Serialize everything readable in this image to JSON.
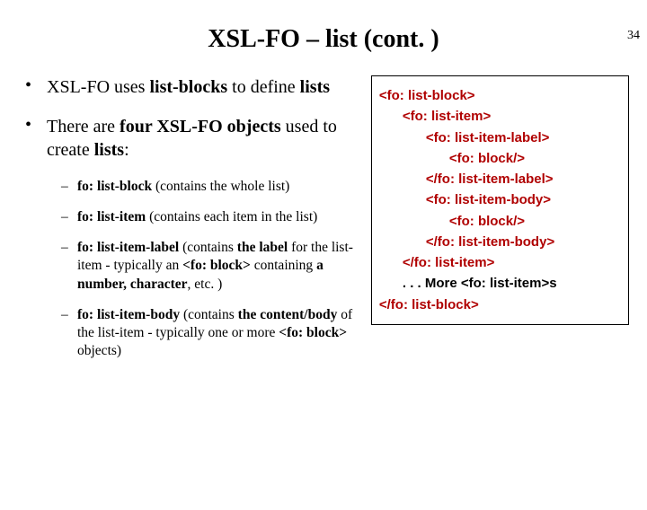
{
  "page_number": "34",
  "title": "XSL-FO – list (cont. )",
  "bullets": {
    "b1": {
      "pre": "XSL-FO uses ",
      "bold1": "list-blocks",
      "mid": " to define ",
      "bold2": "lists"
    },
    "b2": {
      "pre": "There are ",
      "bold1": "four XSL-FO objects",
      "mid": " used to create ",
      "bold2": "lists",
      "post": ":"
    }
  },
  "subs": {
    "s1": {
      "bold": "fo: list-block",
      "rest": " (contains the whole list)"
    },
    "s2": {
      "bold": "fo: list-item",
      "rest": " (contains each item in the list)"
    },
    "s3": {
      "bold": "fo: list-item-label",
      "rest_a": " (contains ",
      "bold_a": "the label",
      "rest_b": " for the list-item - typically an ",
      "bold_b": "<fo: block>",
      "rest_c": " containing ",
      "bold_c": "a number, character",
      "rest_d": ", etc. )"
    },
    "s4": {
      "bold": "fo: list-item-body",
      "rest_a": " (contains ",
      "bold_a": "the content/body",
      "rest_b": " of the list-item - typically one or more ",
      "bold_b": "<fo: block>",
      "rest_c": " objects)"
    }
  },
  "code": {
    "l1": "<fo: list-block>",
    "l2": "<fo: list-item>",
    "l3": "<fo: list-item-label>",
    "l4": "<fo: block/>",
    "l5": "</fo: list-item-label>",
    "l6": "<fo: list-item-body>",
    "l7": "<fo: block/>",
    "l8": "</fo: list-item-body>",
    "l9": "</fo: list-item>",
    "l10": ". . . More <fo: list-item>s",
    "l11": "</fo: list-block>"
  }
}
